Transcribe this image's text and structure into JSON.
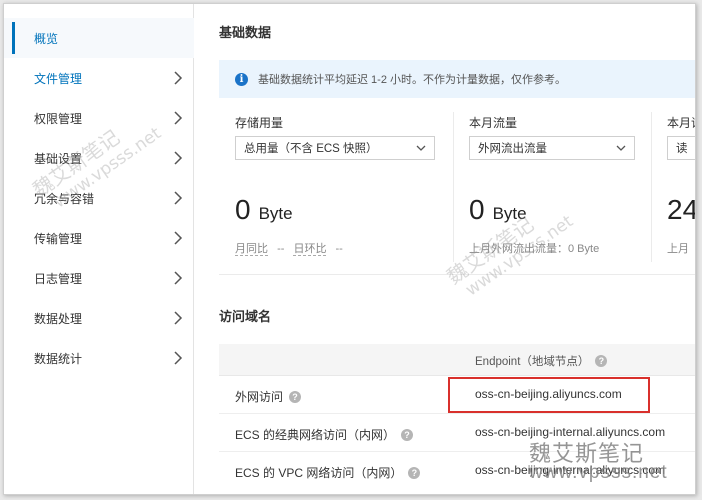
{
  "sidebar": {
    "items": [
      {
        "label": "概览",
        "active": true,
        "chevron": false
      },
      {
        "label": "文件管理",
        "active": false,
        "chevron": true,
        "link": true
      },
      {
        "label": "权限管理",
        "active": false,
        "chevron": true
      },
      {
        "label": "基础设置",
        "active": false,
        "chevron": true
      },
      {
        "label": "冗余与容错",
        "active": false,
        "chevron": true
      },
      {
        "label": "传输管理",
        "active": false,
        "chevron": true
      },
      {
        "label": "日志管理",
        "active": false,
        "chevron": true
      },
      {
        "label": "数据处理",
        "active": false,
        "chevron": true
      },
      {
        "label": "数据统计",
        "active": false,
        "chevron": true
      }
    ]
  },
  "basic_data": {
    "title": "基础数据",
    "notice": "基础数据统计平均延迟 1-2 小时。不作为计量数据，仅作参考。",
    "cards": [
      {
        "label": "存储用量",
        "select": "总用量（不含 ECS 快照）",
        "value": "0",
        "unit": "Byte",
        "sub_a": "月同比",
        "sub_a_val": "--",
        "sub_b": "日环比",
        "sub_b_val": "--"
      },
      {
        "label": "本月流量",
        "select": "外网流出流量",
        "value": "0",
        "unit": "Byte",
        "sub_text": "上月外网流出流量：0 Byte"
      },
      {
        "label": "本月请",
        "select": "读",
        "value": "24",
        "unit": "",
        "sub_text": "上月"
      }
    ]
  },
  "domains": {
    "title": "访问域名",
    "header_endpoint": "Endpoint（地域节点）",
    "rows": [
      {
        "name": "外网访问",
        "endpoint": "oss-cn-beijing.aliyuncs.com"
      },
      {
        "name": "ECS 的经典网络访问（内网）",
        "endpoint": "oss-cn-beijing-internal.aliyuncs.com"
      },
      {
        "name": "ECS 的 VPC 网络访问（内网）",
        "endpoint": "oss-cn-beijing-internal.aliyuncs.com"
      }
    ]
  },
  "watermark": {
    "cn": "魏艾斯笔记",
    "url": "www.vpsss.net"
  },
  "colors": {
    "accent": "#0073bb",
    "highlight": "#d9302c",
    "info": "#1a73c8"
  }
}
